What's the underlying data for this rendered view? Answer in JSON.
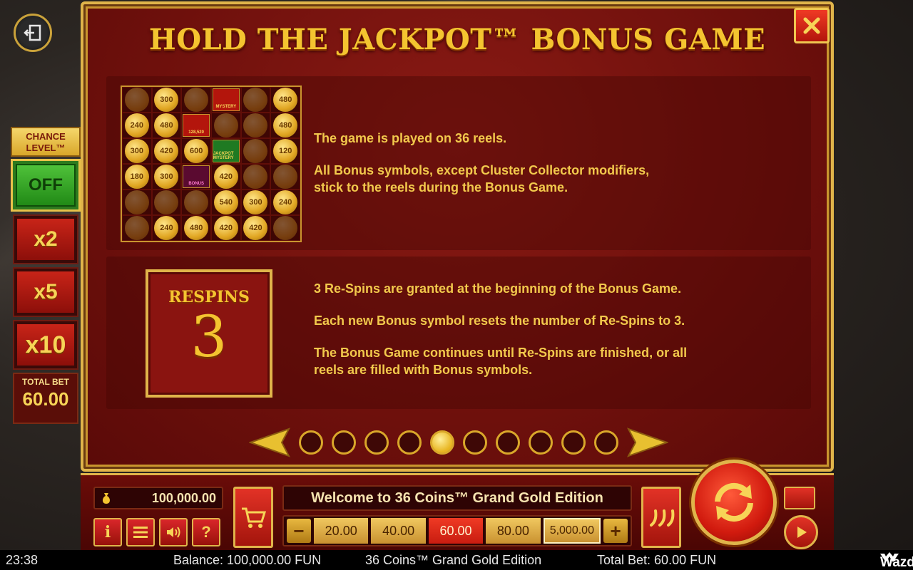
{
  "dialog": {
    "title": "HOLD THE JACKPOT™ BONUS GAME",
    "section1": {
      "grid": [
        [
          "",
          "300",
          "",
          "MYSTERY",
          "",
          "480"
        ],
        [
          "240",
          "480",
          "128,520",
          "",
          "",
          "480"
        ],
        [
          "300",
          "420",
          "600",
          "JACKPOT MYSTERY",
          "",
          "120"
        ],
        [
          "180",
          "300",
          "BONUS",
          "420",
          "",
          ""
        ],
        [
          "",
          "",
          "",
          "540",
          "300",
          "240"
        ],
        [
          "",
          "240",
          "480",
          "420",
          "420",
          ""
        ]
      ],
      "p1": "The game is played on 36 reels.",
      "p2a": "All Bonus symbols, except Cluster Collector modifiers,",
      "p2b": "stick to the reels during the Bonus Game."
    },
    "section2": {
      "respins_label": "RESPINS",
      "respins_number": "3",
      "p1": "3 Re-Spins are granted at the beginning of the Bonus Game.",
      "p2": "Each new Bonus symbol resets the number of Re-Spins to 3.",
      "p3a": "The Bonus Game continues until Re-Spins are finished, or all",
      "p3b": "reels are filled with Bonus symbols."
    },
    "pagination": {
      "total": 10,
      "active": 5
    }
  },
  "chance_level": {
    "title_line1": "CHANCE",
    "title_line2": "LEVEL™",
    "off": "OFF",
    "options": [
      "x2",
      "x5",
      "x10"
    ],
    "total_bet_label": "TOTAL BET",
    "total_bet_value": "60.00"
  },
  "controls": {
    "balance": "100,000.00",
    "welcome": "Welcome to 36 Coins™ Grand Gold Edition",
    "bets": [
      "20.00",
      "40.00",
      "60.00",
      "80.00",
      "5,000.00"
    ],
    "selected_bet_index": 2,
    "small_buttons": {
      "info": "i",
      "help": "?"
    }
  },
  "status": {
    "time": "23:38",
    "balance": "Balance: 100,000.00 FUN",
    "game": "36 Coins™ Grand Gold Edition",
    "total_bet": "Total Bet: 60.00 FUN",
    "brand": "Wazdan"
  },
  "colors": {
    "gold": "#f4c430",
    "dialog_red": "#6e100c",
    "bet_selected": "#ef3a24"
  }
}
